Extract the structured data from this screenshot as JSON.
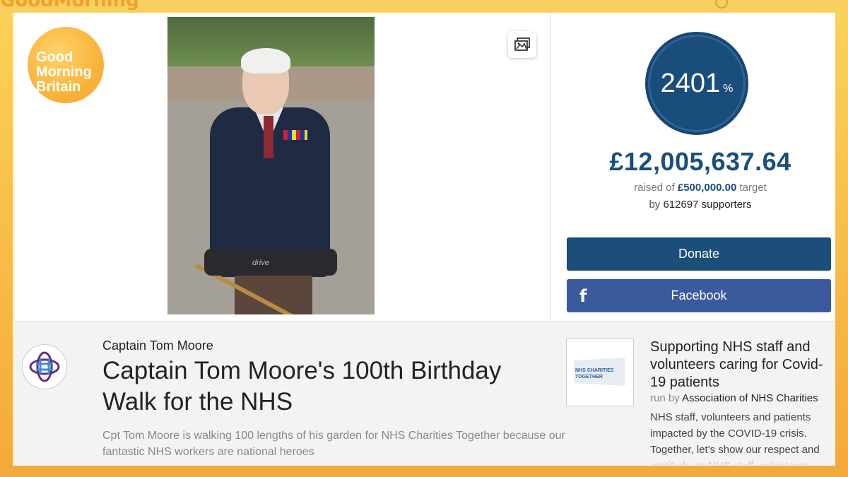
{
  "header": {
    "brand": "GoodMorning"
  },
  "gmb_logo": {
    "line1": "Good",
    "line2": "Morning",
    "line3": "Britain"
  },
  "photo": {
    "walker_text": "drive"
  },
  "stats": {
    "percent": "2401",
    "percent_unit": "%",
    "amount": "£12,005,637.64",
    "raised_prefix": "raised of",
    "target": "£500,000.00",
    "target_suffix": "target",
    "supporters_prefix": "by",
    "supporters": "612697 supporters"
  },
  "actions": {
    "donate_label": "Donate",
    "facebook_label": "Facebook"
  },
  "page": {
    "organiser": "Captain Tom Moore",
    "title": "Captain Tom Moore's 100th Birthday Walk for the NHS",
    "description": "Cpt Tom Moore is walking 100 lengths of his garden for NHS Charities Together because our fantastic NHS workers are national heroes"
  },
  "cause": {
    "logo_text_1": "NHS CHARITIES",
    "logo_text_2": "TOGETHER",
    "title": "Supporting NHS staff and volunteers caring for Covid-19 patients",
    "run_by_prefix": "run by",
    "run_by": "Association of NHS Charities",
    "description": "NHS staff, volunteers and patients impacted by the COVID-19 crisis. Together, let's show our respect and gratitude as NHS staff, volunteers..."
  },
  "colors": {
    "accent_blue": "#1b4e78",
    "facebook_blue": "#3b5a9e",
    "gmb_orange": "#f9b33a"
  },
  "icons": {
    "gallery": "image-gallery-icon",
    "facebook": "facebook-icon",
    "charity": "nhs-charity-logo-icon"
  }
}
